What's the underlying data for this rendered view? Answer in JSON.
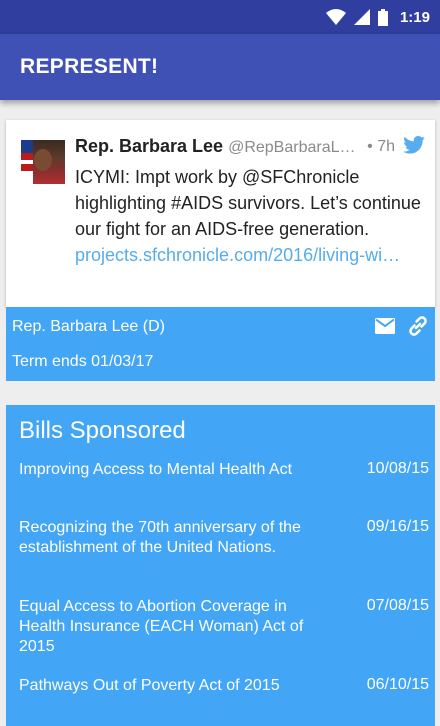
{
  "status_bar": {
    "time": "1:19"
  },
  "app_bar": {
    "title": "REPRESENT!"
  },
  "tweet": {
    "name": "Rep. Barbara Lee",
    "handle": "@RepBarbaraL…",
    "time": "• 7h",
    "text": "ICYMI: Impt work by @SFChronicle highlighting #AIDS survivors. Let’s continue our fight for an AIDS-free generation. ",
    "link": "projects.sfchronicle.com/2016/living-wi…"
  },
  "representative": {
    "name_party": "Rep. Barbara Lee (D)",
    "term": "Term ends 01/03/17"
  },
  "bills": {
    "title": "Bills Sponsored",
    "items": [
      {
        "name": "Improving Access to Mental Health Act",
        "date": "10/08/15"
      },
      {
        "name": "Recognizing the 70th anniversary of the establishment of the United Nations.",
        "date": "09/16/15"
      },
      {
        "name": "Equal Access to Abortion Coverage in Health Insurance (EACH Woman) Act of 2015",
        "date": "07/08/15"
      },
      {
        "name": "Pathways Out of Poverty Act of 2015",
        "date": "06/10/15"
      }
    ]
  },
  "colors": {
    "status_bar": "#303f9f",
    "app_bar": "#3f51b5",
    "card_blue": "#42a5f5",
    "twitter": "#55acee"
  }
}
